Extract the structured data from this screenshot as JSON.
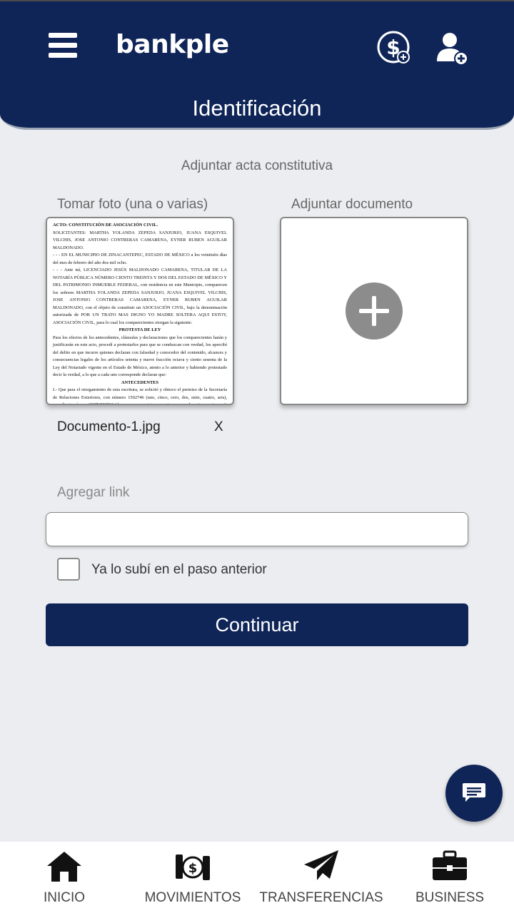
{
  "header": {
    "brand": "bankple",
    "title": "Identificación",
    "icons": [
      "menu-icon",
      "dollar-add-icon",
      "user-add-icon"
    ],
    "color": "#0f2558"
  },
  "main": {
    "subtitle": "Adjuntar acta constitutiva",
    "take_photo_label": "Tomar foto (una o varias)",
    "attach_doc_label": "Adjuntar documento",
    "file": {
      "name": "Documento-1.jpg",
      "remove": "X"
    },
    "link_label": "Agregar link",
    "link_value": "",
    "checkbox_label": "Ya lo subí en el paso anterior",
    "continue_label": "Continuar"
  },
  "doc_preview": {
    "line1": "ACTO: CONSTITUCIÓN DE ASOCIACIÓN CIVIL.",
    "line2": "SOLICITANTES: MARTHA YOLANDA ZEPEDA SANJURJO, JUANA ESQUIVEL VILCHIS, JOSE ANTONIO CONTRERAS CAMARENA, EYNER RUBEN AGUILAR MALDONADO.",
    "line3": "- - - EN EL MUNICIPIO DE ZINACANTEPEC, ESTADO DE MÉXICO a los veintiséis días del mes de febrero del año dos mil ocho.",
    "line4": "- - - Ante mí, LICENCIADO JESÚS MALDONADO CAMARENA, TITULAR DE LA NOTARÍA PÚBLICA NÚMERO CIENTO TREINTA Y DOS DEL ESTADO DE MÉXICO Y DEL PATRIMONIO INMUEBLE FEDERAL, con residencia en este Municipio, comparecen los señores MARTHA YOLANDA ZEPEDA SANJURJO, JUANA ESQUIVEL VILCHIS, JOSE ANTONIO CONTRERAS CAMARENA, EYNER RUBEN AGUILAR MALDONADO, con el objeto de constituir un ASOCIACIÓN CIVIL, bajo la denominación autorizada de POR UN TRATO MAS DIGNO YO MADRE SOLTERA AQUI ESTOY, ASOCIACIÓN CIVIL, para lo cual los comparecientes otorgan la siguiente:",
    "heading1": "PROTESTA DE LEY",
    "line5": "Para los efectos de los antecedentes, cláusulas y declaraciones que los comparecientes harán y justificarán en este acto, procedí a protestarlos para que se conduzcan con verdad, los apercibí del delito en que incurre quienes declaran con falsedad y conocedor del contenido, alcances y consecuencias legales de los artículos setenta y nueve fracción octava y ciento sesenta de la Ley del Notariado vigente en el Estado de México, atento a lo anterior y habiendo protestado decir la verdad, a lo que a cada uno corresponde declaran que:",
    "heading2": "ANTECEDENTES",
    "line6": "I.- Que para el otorgamiento de esta escritura, se solicitó y obtuvo el permiso de la Secretaría de Relaciones Exteriores, con número 1502746 (uno, cinco, cero, dos, siete, cuatro, seis), expediente número 20071502561 (dos, cero, cero, siete, uno, cinco, cero, dos, cinco, seis, uno), folio número 071206151009 (cero, siete, uno, dos, cero, seis, uno, cinco, uno, cero, cero,"
  },
  "chat": {
    "icon": "chat-icon"
  },
  "bottom_nav": [
    {
      "label": "INICIO",
      "icon": "home-icon"
    },
    {
      "label": "MOVIMIENTOS",
      "icon": "money-transfer-icon"
    },
    {
      "label": "TRANSFERENCIAS",
      "icon": "paper-plane-icon"
    },
    {
      "label": "BUSINESS",
      "icon": "briefcase-icon"
    }
  ]
}
